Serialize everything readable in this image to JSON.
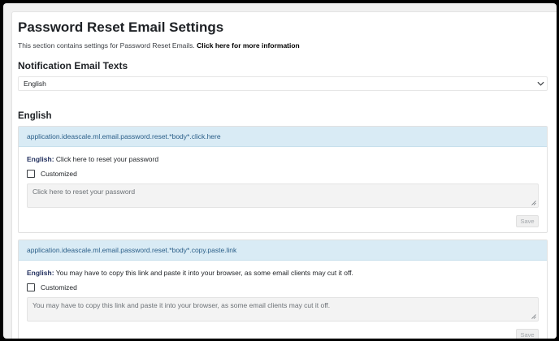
{
  "page": {
    "title": "Password Reset Email Settings",
    "subtitle": "This section contains settings for Password Reset Emails.",
    "more_link": "Click here for more information"
  },
  "notification": {
    "heading": "Notification Email Texts",
    "language_select": {
      "selected": "English",
      "icon": "chevron-down-icon"
    }
  },
  "language_section": {
    "heading": "English",
    "cards": [
      {
        "key": "application.ideascale.ml.email.password.reset.*body*.click.here",
        "language_label": "English:",
        "default_text": "Click here to reset your password",
        "customized_label": "Customized",
        "customized_checked": false,
        "textarea_value": "Click here to reset your password",
        "save_label": "Save"
      },
      {
        "key": "application.ideascale.ml.email.password.reset.*body*.copy.paste.link",
        "language_label": "English:",
        "default_text": "You may have to copy this link and paste it into your browser, as some email clients may cut it off.",
        "customized_label": "Customized",
        "customized_checked": false,
        "textarea_value": "You may have to copy this link and paste it into your browser, as some email clients may cut it off.",
        "save_label": "Save"
      }
    ]
  },
  "colors": {
    "card_header_bg": "#d9ebf5",
    "card_header_text": "#2a5e88",
    "language_label": "#1f2d5c"
  }
}
